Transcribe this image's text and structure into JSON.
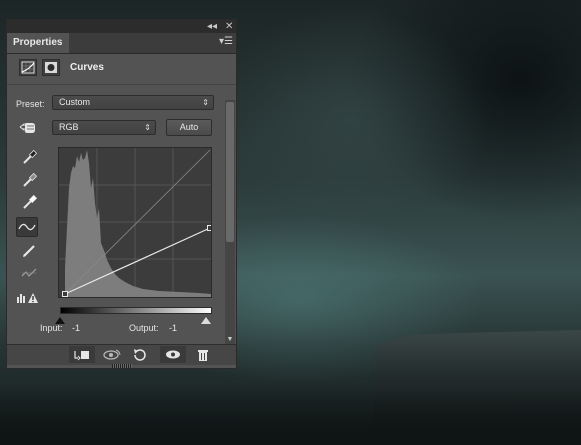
{
  "panel": {
    "tab_label": "Properties",
    "adjustment_title": "Curves",
    "preset_label": "Preset:",
    "preset_value": "Custom",
    "channel_value": "RGB",
    "auto_label": "Auto",
    "input_label": "Input:",
    "input_value": "-1",
    "output_label": "Output:",
    "output_value": "-1"
  },
  "icons": {
    "collapse": "double-chevron-icon",
    "close": "close-icon",
    "menu": "panel-menu-icon",
    "adjustment": "curves-adjustment-icon",
    "mask": "layer-mask-icon"
  },
  "colors": {
    "panel_bg": "#535353",
    "dark_bar": "#2c2c2c",
    "text": "#e6e6e6"
  }
}
